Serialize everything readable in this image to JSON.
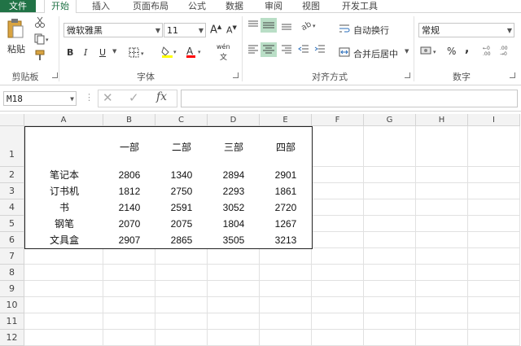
{
  "menu": {
    "file": "文件",
    "tabs": [
      "开始",
      "插入",
      "页面布局",
      "公式",
      "数据",
      "审阅",
      "视图",
      "开发工具"
    ]
  },
  "ribbon": {
    "clipboard": {
      "paste": "粘贴",
      "label": "剪贴板"
    },
    "font": {
      "name": "微软雅黑",
      "size": "11",
      "bold": "B",
      "italic": "I",
      "underline": "U",
      "wen": "wén",
      "label": "字体"
    },
    "alignment": {
      "wrap": "自动换行",
      "merge": "合并后居中",
      "label": "对齐方式"
    },
    "number": {
      "format": "常规",
      "percent": "%",
      "comma": ",",
      "label": "数字"
    }
  },
  "formula_bar": {
    "name_box": "M18",
    "fx": "fx",
    "value": ""
  },
  "columns": [
    "A",
    "B",
    "C",
    "D",
    "E",
    "F",
    "G",
    "H",
    "I"
  ],
  "rows": [
    "1",
    "2",
    "3",
    "4",
    "5",
    "6",
    "7",
    "8",
    "9",
    "10",
    "11",
    "12"
  ],
  "table": {
    "headers": [
      "一部",
      "二部",
      "三部",
      "四部"
    ],
    "rows": [
      {
        "label": "笔记本",
        "values": [
          "2806",
          "1340",
          "2894",
          "2901"
        ]
      },
      {
        "label": "订书机",
        "values": [
          "1812",
          "2750",
          "2293",
          "1861"
        ]
      },
      {
        "label": "书",
        "values": [
          "2140",
          "2591",
          "3052",
          "2720"
        ]
      },
      {
        "label": "钢笔",
        "values": [
          "2070",
          "2075",
          "1804",
          "1267"
        ]
      },
      {
        "label": "文具盒",
        "values": [
          "2907",
          "2865",
          "3505",
          "3213"
        ]
      }
    ]
  },
  "colors": {
    "accent": "#217346",
    "highlight": "#ffff00",
    "font_color": "#ff0000",
    "selected_align_bg": "#b9dec6"
  }
}
